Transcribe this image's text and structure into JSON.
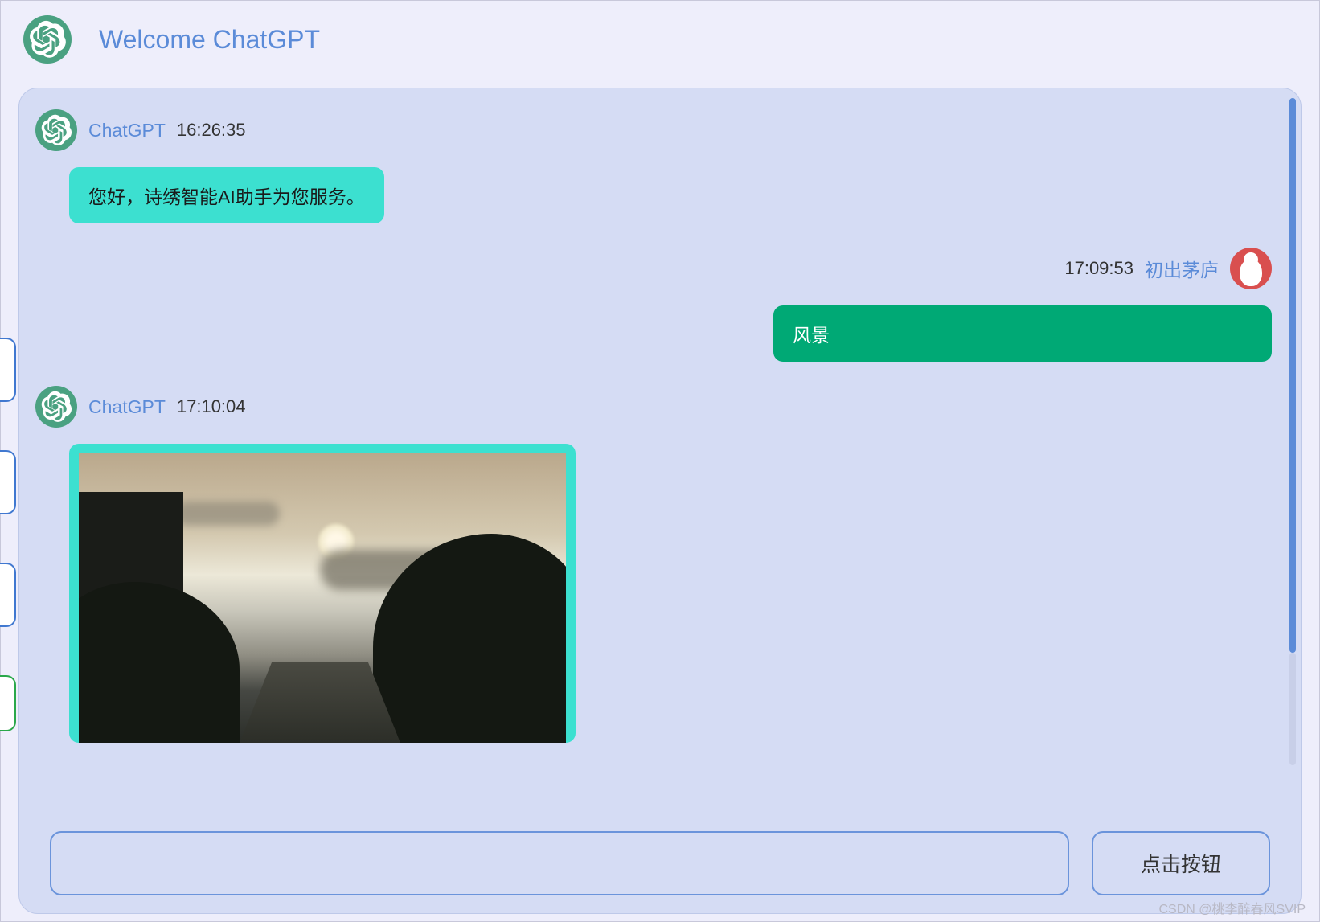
{
  "header": {
    "title": "Welcome ChatGPT"
  },
  "messages": [
    {
      "role": "bot",
      "name": "ChatGPT",
      "time": "16:26:35",
      "text": "您好，诗绣智能AI助手为您服务。"
    },
    {
      "role": "user",
      "name": "初出茅庐",
      "time": "17:09:53",
      "text": "风景"
    },
    {
      "role": "bot",
      "name": "ChatGPT",
      "time": "17:10:04",
      "image": true
    }
  ],
  "input": {
    "value": "",
    "button": "点击按钮"
  },
  "watermark": "CSDN @桃李醉春风SVIP",
  "colors": {
    "accent": "#5b8bd8",
    "botBubble": "#3ce0d0",
    "userBubble": "#00a975",
    "panel": "#d5dcf4"
  }
}
